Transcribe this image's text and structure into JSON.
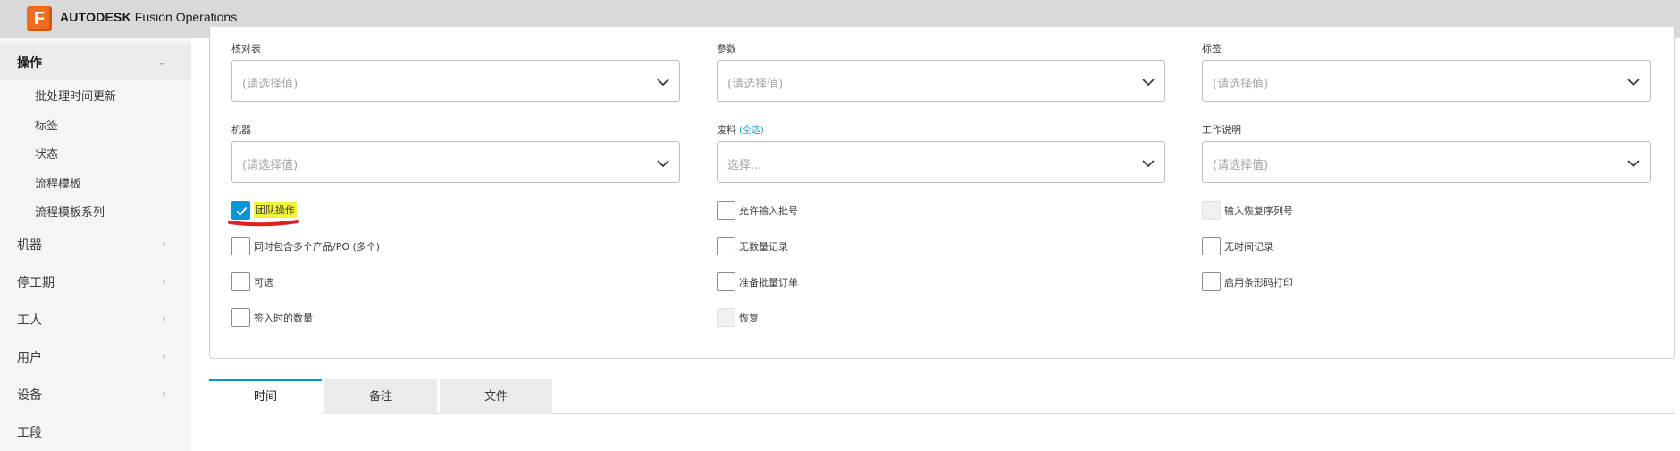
{
  "header": {
    "logo_letter": "F",
    "brand_bold": "AUTODESK",
    "brand_rest": " Fusion Operations",
    "accent": "#f26c1d"
  },
  "sidebar": {
    "groups": [
      {
        "label": "操作",
        "expanded": true
      },
      {
        "label": "机器"
      },
      {
        "label": "停工期"
      },
      {
        "label": "工人"
      },
      {
        "label": "用户"
      },
      {
        "label": "设备"
      },
      {
        "label": "工段"
      }
    ],
    "sub_items": [
      "批处理时间更新",
      "标签",
      "状态",
      "流程模板",
      "流程模板系列"
    ]
  },
  "form": {
    "fields": {
      "checklist": {
        "label": "核对表",
        "placeholder": "(请选择值)"
      },
      "parameters": {
        "label": "参数",
        "placeholder": "(请选择值)"
      },
      "labels": {
        "label": "标签",
        "placeholder": "(请选择值)"
      },
      "machine": {
        "label": "机器",
        "placeholder": "(请选择值)"
      },
      "scrap": {
        "label": "废料",
        "select_all": "(全选)",
        "placeholder": "选择..."
      },
      "work_instructions": {
        "label": "工作说明",
        "placeholder": "(请选择值)"
      }
    },
    "checkboxes": {
      "team_operation": {
        "label": "团队操作",
        "checked": true
      },
      "multi_product_po": {
        "label": "同时包含多个产品/PO (多个)",
        "checked": false
      },
      "optional": {
        "label": "可选",
        "checked": false
      },
      "checkin_quantity": {
        "label": "签入时的数量",
        "checked": false
      },
      "allow_batch_input": {
        "label": "允许输入批号",
        "checked": false
      },
      "no_quantity_record": {
        "label": "无数量记录",
        "checked": false
      },
      "prepare_batch_order": {
        "label": "准备批量订单",
        "checked": false
      },
      "recover": {
        "label": "恢复",
        "checked": false,
        "disabled": true
      },
      "input_recovery_serial": {
        "label": "输入恢复序列号",
        "checked": false,
        "disabled": true
      },
      "no_time_record": {
        "label": "无时间记录",
        "checked": false
      },
      "enable_barcode_print": {
        "label": "启用条形码打印",
        "checked": false
      }
    }
  },
  "tabs": [
    {
      "label": "时间",
      "active": true
    },
    {
      "label": "备注"
    },
    {
      "label": "文件"
    }
  ],
  "colors": {
    "primary": "#0696d7",
    "highlight": "#f4f43a",
    "annotation": "#e02020"
  }
}
